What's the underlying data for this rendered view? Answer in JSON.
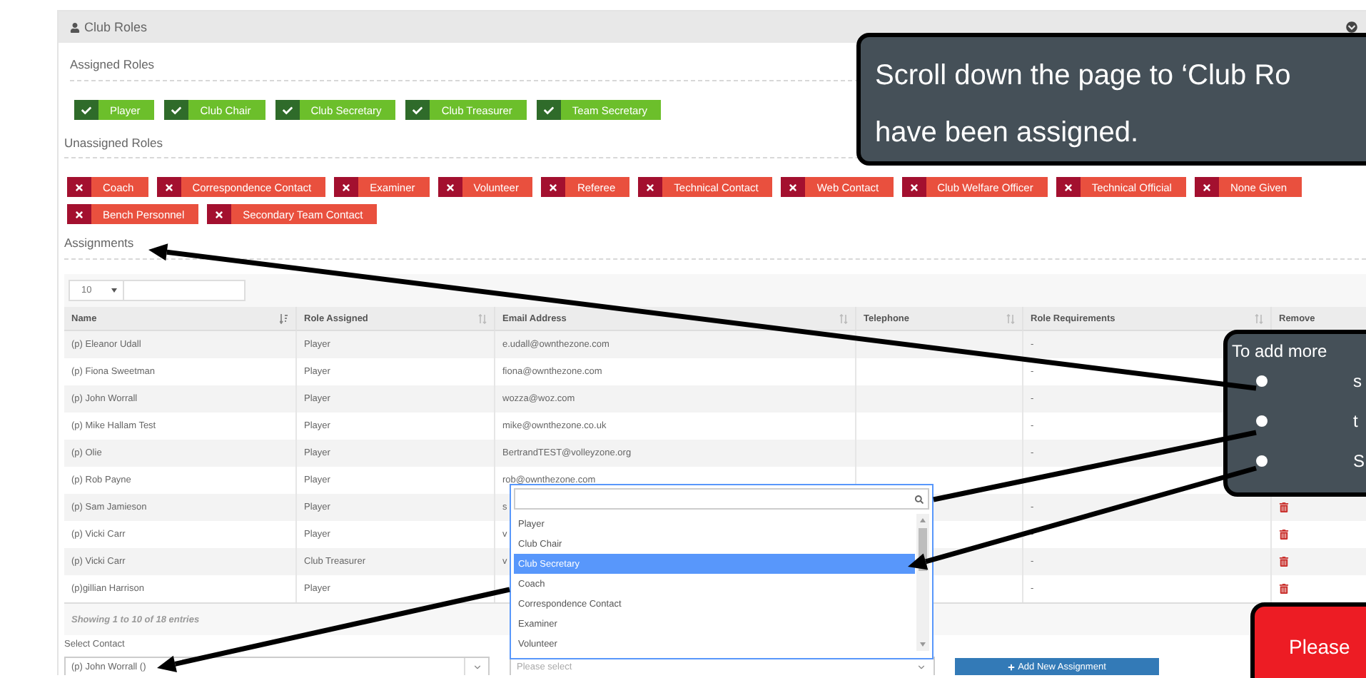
{
  "panel": {
    "title": "Club Roles"
  },
  "assigned_roles": {
    "heading": "Assigned Roles",
    "roles": [
      "Player",
      "Club Chair",
      "Club Secretary",
      "Club Treasurer",
      "Team Secretary"
    ]
  },
  "unassigned_roles": {
    "heading": "Unassigned Roles",
    "roles": [
      "Coach",
      "Correspondence Contact",
      "Examiner",
      "Volunteer",
      "Referee",
      "Technical Contact",
      "Web Contact",
      "Club Welfare Officer",
      "Technical Official",
      "None Given",
      "Bench Personnel",
      "Secondary Team Contact"
    ]
  },
  "assignments": {
    "heading": "Assignments",
    "page_length": "10",
    "columns": [
      {
        "label": "Name",
        "sorted": true
      },
      {
        "label": "Role Assigned",
        "sorted": false
      },
      {
        "label": "Email Address",
        "sorted": false
      },
      {
        "label": "Telephone",
        "sorted": false
      },
      {
        "label": "Role Requirements",
        "sorted": false
      },
      {
        "label": "Remove"
      }
    ],
    "rows": [
      {
        "name": "(p) Eleanor Udall",
        "role": "Player",
        "email": "e.udall@ownthezone.com",
        "requirements": "-"
      },
      {
        "name": "(p) Fiona Sweetman",
        "role": "Player",
        "email": "fiona@ownthezone.com",
        "requirements": "-"
      },
      {
        "name": "(p) John Worrall",
        "role": "Player",
        "email": "wozza@woz.com",
        "requirements": "-"
      },
      {
        "name": "(p) Mike Hallam Test",
        "role": "Player",
        "email": "mike@ownthezone.co.uk",
        "requirements": "-"
      },
      {
        "name": "(p) Olie",
        "role": "Player",
        "email": "BertrandTEST@volleyzone.org",
        "requirements": "-"
      },
      {
        "name": "(p) Rob Payne",
        "role": "Player",
        "email": "rob@ownthezone.com"
      },
      {
        "name": "(p) Sam Jamieson",
        "role": "Player",
        "email": "s",
        "requirements": "-",
        "remove_icon": true
      },
      {
        "name": "(p) Vicki Carr",
        "role": "Player",
        "email": "v",
        "requirements": "-",
        "remove_icon": true
      },
      {
        "name": "(p) Vicki Carr",
        "role": "Club Treasurer",
        "email": "v",
        "requirements": "-",
        "remove_icon": true
      },
      {
        "name": "(p)gillian Harrison",
        "role": "Player",
        "requirements": "-",
        "remove_icon": true
      }
    ],
    "info": "Showing 1 to 10 of 18 entries"
  },
  "select_contact": {
    "label": "Select Contact",
    "value": "(p) John Worrall ()"
  },
  "role_select": {
    "placeholder": "Please select",
    "options": [
      {
        "label": "Player",
        "selected": false
      },
      {
        "label": "Club Chair",
        "selected": false
      },
      {
        "label": "Club Secretary",
        "selected": true
      },
      {
        "label": "Coach",
        "selected": false
      },
      {
        "label": "Correspondence Contact",
        "selected": false
      },
      {
        "label": "Examiner",
        "selected": false
      },
      {
        "label": "Volunteer",
        "selected": false
      }
    ]
  },
  "add_button": "Add New Assignment",
  "callouts": [
    {
      "kind": "note",
      "lines": [
        "Scroll down the page to ‘Club Ro",
        "have been assigned."
      ]
    },
    {
      "kind": "steps",
      "title": "To add more",
      "bullets": [
        "s",
        "t",
        "S"
      ]
    },
    {
      "kind": "alert",
      "lines": [
        "Please"
      ]
    }
  ]
}
